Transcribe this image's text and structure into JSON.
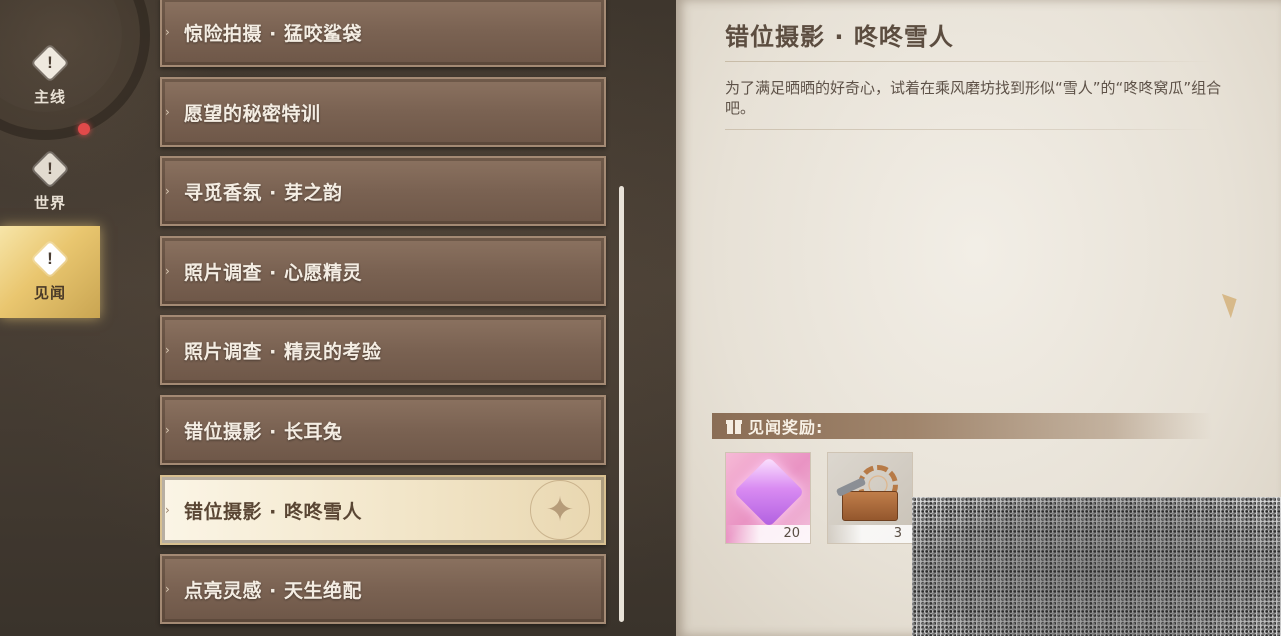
{
  "nav": {
    "items": [
      {
        "label": "主线",
        "icon": "exclamation-diamond-icon"
      },
      {
        "label": "世界",
        "icon": "exclamation-diamond-icon"
      },
      {
        "label": "见闻",
        "icon": "exclamation-diamond-icon"
      }
    ],
    "active_index": 2,
    "notification_color": "#e14a4a"
  },
  "quests": [
    {
      "label": "惊险拍摄 · 猛咬鲨袋"
    },
    {
      "label": "愿望的秘密特训"
    },
    {
      "label": "寻觅香氛 · 芽之韵"
    },
    {
      "label": "照片调查 · 心愿精灵"
    },
    {
      "label": "照片调查 · 精灵的考验"
    },
    {
      "label": "错位摄影 · 长耳兔"
    },
    {
      "label": "错位摄影 · 咚咚雪人"
    },
    {
      "label": "点亮灵感 · 天生绝配"
    }
  ],
  "selected_quest_index": 6,
  "detail": {
    "title": "错位摄影 · 咚咚雪人",
    "description": "为了满足晒晒的好奇心，试着在乘风磨坊找到形似“雪人”的“咚咚窝瓜”组合吧。"
  },
  "rewards": {
    "header": "见闻奖励:",
    "items": [
      {
        "icon": "pink-crystal-icon",
        "quantity": "20"
      },
      {
        "icon": "toolbox-icon",
        "quantity": "3"
      }
    ]
  },
  "colors": {
    "accent_gold": "#e9c66f",
    "selected_item": "#f1e4c6",
    "list_item": "#7a6252"
  }
}
